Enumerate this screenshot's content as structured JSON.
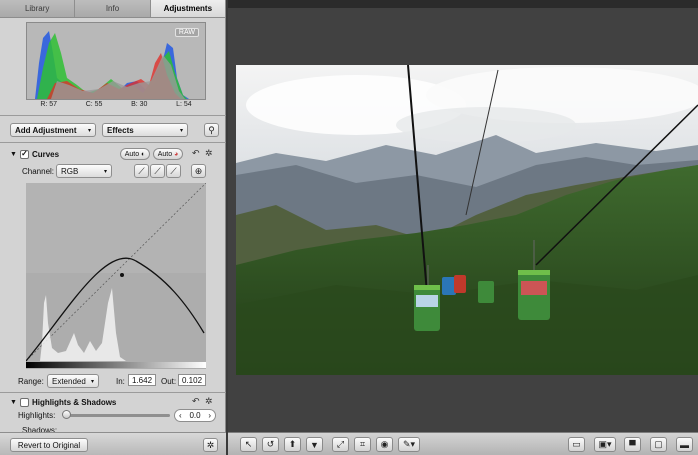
{
  "inspector": {
    "tabs": [
      {
        "label": "Library",
        "active": false
      },
      {
        "label": "Info",
        "active": false
      },
      {
        "label": "Adjustments",
        "active": true
      }
    ],
    "histogram": {
      "raw_tag": "RAW",
      "readouts": [
        "R: 57",
        "C: 55",
        "B: 30",
        "L: 54"
      ]
    },
    "add_adjustment_label": "Add Adjustment",
    "effects_label": "Effects",
    "curves": {
      "title": "Curves",
      "auto_rgb": "Auto",
      "auto_sep": "Auto",
      "channel_label": "Channel:",
      "channel_value": "RGB",
      "range_label": "Range:",
      "range_value": "Extended",
      "in_label": "In:",
      "in_value": "1.642",
      "out_label": "Out:",
      "out_value": "0.102"
    },
    "highlights_shadows": {
      "title": "Highlights & Shadows",
      "highlights_label": "Highlights:",
      "highlights_value": "0.0",
      "shadows_label": "Shadows:"
    },
    "revert_label": "Revert to Original"
  },
  "colors": {
    "panel_bg": "#d3d3d3",
    "viewer_bg": "#414141",
    "hist_red": "#e0302a",
    "hist_green": "#2fbf34",
    "hist_blue": "#2c5fe0"
  },
  "toolbar_icons": [
    "select-arrow-icon",
    "rotate-icon",
    "lift-icon",
    "stamp-icon",
    "straighten-icon",
    "crop-icon",
    "red-eye-icon",
    "brush-icon",
    "view-mode-icon",
    "loupe-icon",
    "compare-icon",
    "slideshow-icon",
    "fullscreen-icon"
  ]
}
